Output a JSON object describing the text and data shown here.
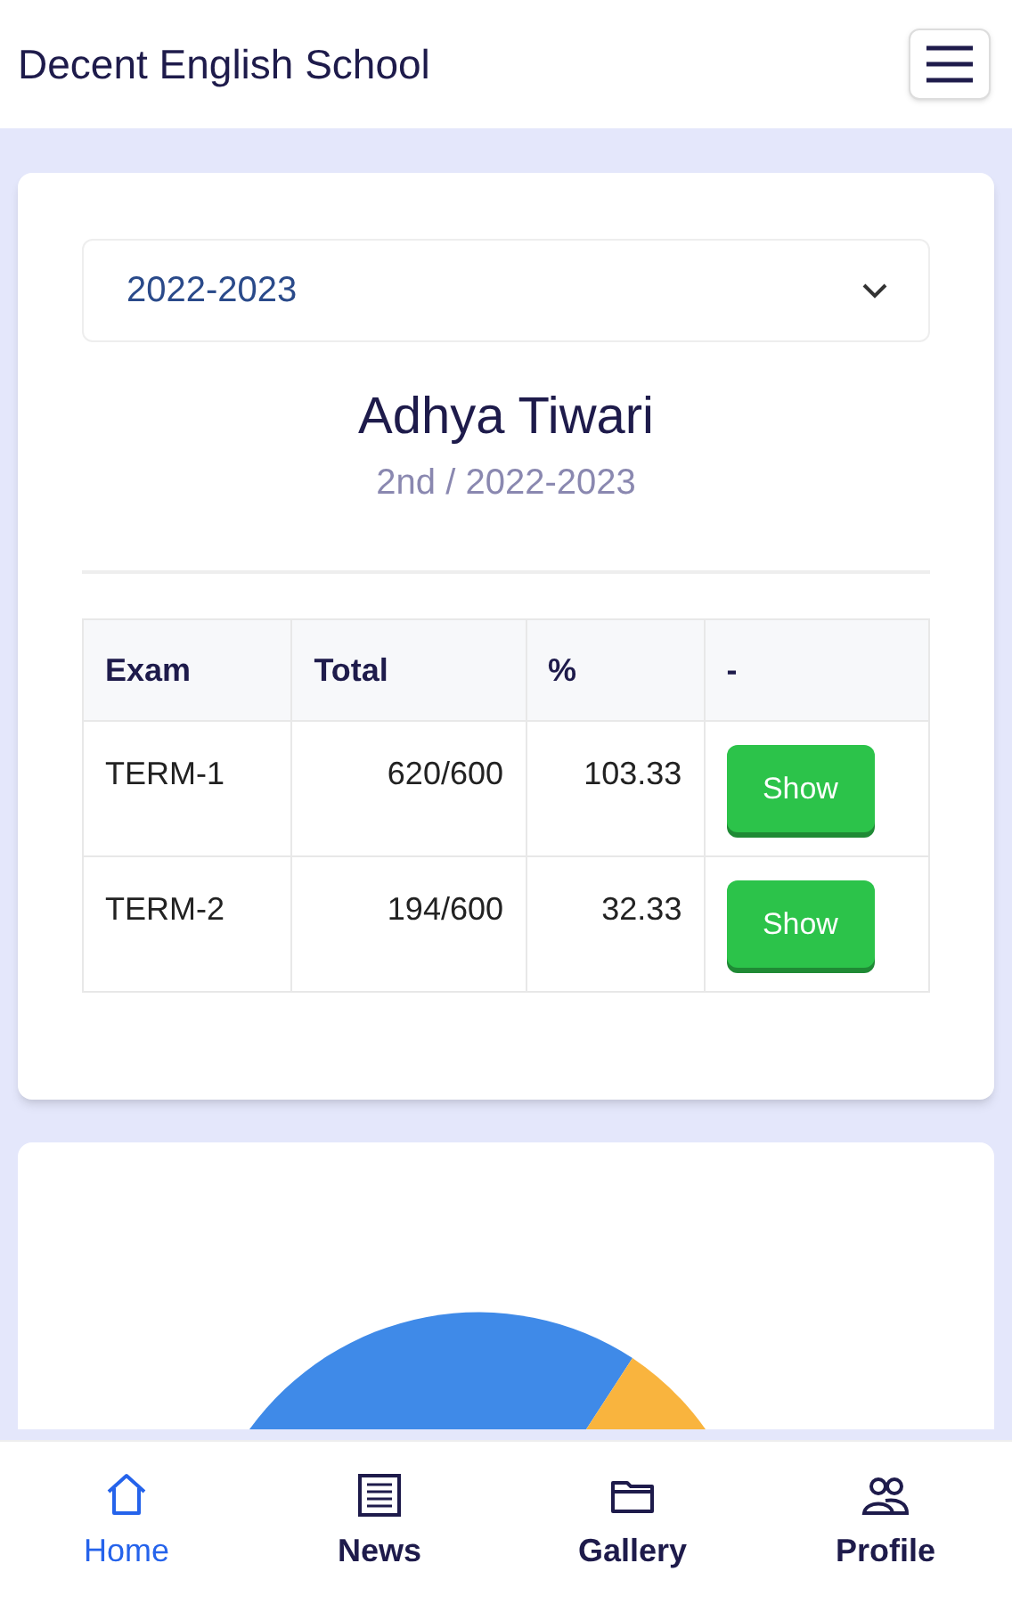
{
  "header": {
    "title": "Decent English School"
  },
  "session_select": {
    "value": "2022-2023"
  },
  "student": {
    "name": "Adhya Tiwari",
    "subtitle": "2nd / 2022-2023"
  },
  "table": {
    "columns": [
      "Exam",
      "Total",
      "%",
      "-"
    ],
    "rows": [
      {
        "exam": "TERM-1",
        "total": "620/600",
        "percent": "103.33",
        "action": "Show"
      },
      {
        "exam": "TERM-2",
        "total": "194/600",
        "percent": "32.33",
        "action": "Show"
      }
    ]
  },
  "bottom_nav": [
    {
      "label": "Home",
      "kind": "home",
      "selected": true
    },
    {
      "label": "News",
      "kind": "news",
      "selected": false
    },
    {
      "label": "Gallery",
      "kind": "folder",
      "selected": false
    },
    {
      "label": "Profile",
      "kind": "people",
      "selected": false
    }
  ]
}
